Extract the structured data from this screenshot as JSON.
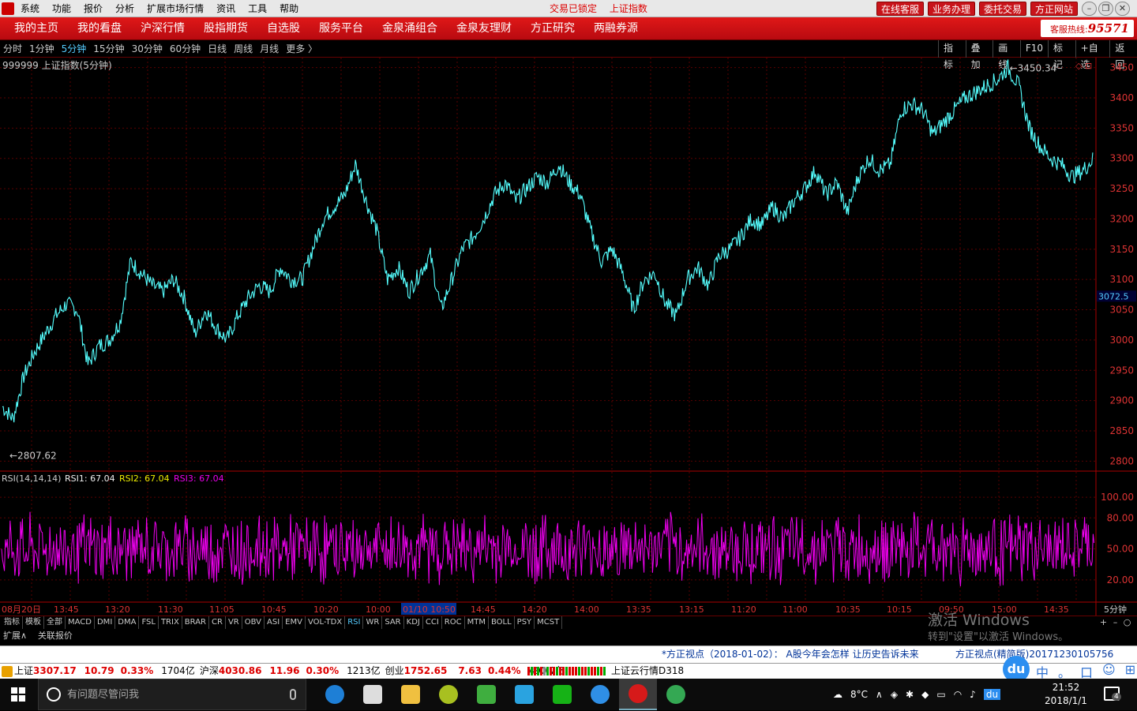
{
  "menubar": {
    "items": [
      "系统",
      "功能",
      "报价",
      "分析",
      "扩展市场行情",
      "资讯",
      "工具",
      "帮助"
    ],
    "lock_status": "交易已锁定",
    "current_index": "上证指数",
    "buttons": [
      "在线客服",
      "业务办理",
      "委托交易",
      "方正网站"
    ]
  },
  "navbar": {
    "items": [
      "我的主页",
      "我的看盘",
      "沪深行情",
      "股指期货",
      "自选股",
      "服务平台",
      "金泉涌组合",
      "金泉友理财",
      "方正研究",
      "两融券源"
    ],
    "hotline_label": "客服热线:",
    "hotline_number": "95571"
  },
  "periodbar": {
    "periods": [
      "分时",
      "1分钟",
      "5分钟",
      "15分钟",
      "30分钟",
      "60分钟",
      "日线",
      "周线",
      "月线",
      "更多 〉"
    ],
    "active_period": 2,
    "tools": [
      "指标",
      "叠加",
      "画线",
      "F10",
      "标记",
      "+自选",
      "返回"
    ]
  },
  "chart_data": {
    "type": "line",
    "title": "999999 上证指数(5分钟)",
    "ylim": [
      2790,
      3460
    ],
    "yticks": [
      "3450",
      "3400",
      "3350",
      "3300",
      "3250",
      "3200",
      "3150",
      "3100",
      "3050",
      "3000",
      "2950",
      "2900",
      "2850",
      "2800"
    ],
    "current_price": "3072.5",
    "max_label": "3450.34",
    "min_label": "2807.62",
    "series": [
      {
        "name": "上证指数",
        "color": "#5ff",
        "values": [
          2890,
          2870,
          2940,
          2980,
          3010,
          3040,
          3060,
          3050,
          2960,
          2990,
          3000,
          3030,
          3130,
          3110,
          3090,
          3080,
          3100,
          3070,
          3010,
          3050,
          3020,
          3000,
          3040,
          3070,
          3090,
          3080,
          3120,
          3100,
          3100,
          3150,
          3200,
          3220,
          3240,
          3290,
          3230,
          3180,
          3100,
          3120,
          3080,
          3110,
          3140,
          3050,
          3100,
          3150,
          3170,
          3200,
          3240,
          3260,
          3230,
          3250,
          3270,
          3260,
          3290,
          3260,
          3240,
          3180,
          3130,
          3150,
          3110,
          3050,
          3100,
          3110,
          3060,
          3040,
          3100,
          3120,
          3090,
          3140,
          3150,
          3170,
          3200,
          3190,
          3220,
          3200,
          3230,
          3250,
          3280,
          3240,
          3260,
          3210,
          3270,
          3300,
          3280,
          3290,
          3380,
          3390,
          3380,
          3340,
          3360,
          3380,
          3400,
          3410,
          3420,
          3430,
          3450,
          3420,
          3350,
          3320,
          3300,
          3290,
          3270,
          3280,
          3300
        ]
      }
    ]
  },
  "rsi": {
    "label": "RSI(14,14,14)",
    "rsi1": "RSI1: 67.04",
    "rsi2": "RSI2: 67.04",
    "rsi3": "RSI3: 67.04",
    "ylim": [
      0,
      110
    ],
    "yticks": [
      "100.00",
      "80.00",
      "50.00",
      "20.00"
    ],
    "color": "#e0e"
  },
  "xaxis": {
    "labels": [
      "08月20日",
      "13:45",
      "13:20",
      "11:30",
      "11:05",
      "10:45",
      "10:20",
      "10:00",
      "01/10 10:50",
      "14:45",
      "14:20",
      "14:00",
      "13:35",
      "13:15",
      "11:20",
      "11:00",
      "10:35",
      "10:15",
      "09:50",
      "15:00",
      "14:35"
    ],
    "highlight_index": 8,
    "period_label": "5分钟"
  },
  "tabbar": {
    "tabs": [
      "指标",
      "模板",
      "全部",
      "MACD",
      "DMI",
      "DMA",
      "FSL",
      "TRIX",
      "BRAR",
      "CR",
      "VR",
      "OBV",
      "ASI",
      "EMV",
      "VOL-TDX",
      "RSI",
      "WR",
      "SAR",
      "KDJ",
      "CCI",
      "ROC",
      "MTM",
      "BOLL",
      "PSY",
      "MCST"
    ],
    "active_tab": 15,
    "right_buttons": [
      "+",
      "–",
      "○"
    ]
  },
  "extbar": {
    "items": [
      "扩展∧",
      "关联报价"
    ]
  },
  "watermark": {
    "line1": "激活 Windows",
    "line2": "转到\"设置\"以激活 Windows。"
  },
  "newsbar": {
    "headline": "*方正视点（2018-01-02）： A股今年会怎样   让历史告诉未来",
    "ticker": "方正视点(精简版)20171230105756"
  },
  "statusbar": {
    "sh_label": "上证",
    "sh_value": "3307.17",
    "sh_change": "10.79",
    "sh_pct": "0.33%",
    "sh_amount": "1704亿",
    "sz_label": "沪深",
    "sz_value": "4030.86",
    "sz_change": "11.96",
    "sz_pct": "0.30%",
    "sz_amount": "1213亿",
    "cy_label": "创业",
    "cy_value": "1752.65",
    "cy_change": "7.63",
    "cy_pct": "0.44%",
    "cy_amount": "490.7亿",
    "cloud": "上证云行情D318",
    "du": "du",
    "ime": [
      "中",
      "。",
      "口",
      "☺",
      "⊞"
    ]
  },
  "taskbar": {
    "search_placeholder": "有问题尽管问我",
    "temperature": "8°C",
    "time": "21:52",
    "date": "2018/1/1",
    "notif_count": "4"
  }
}
